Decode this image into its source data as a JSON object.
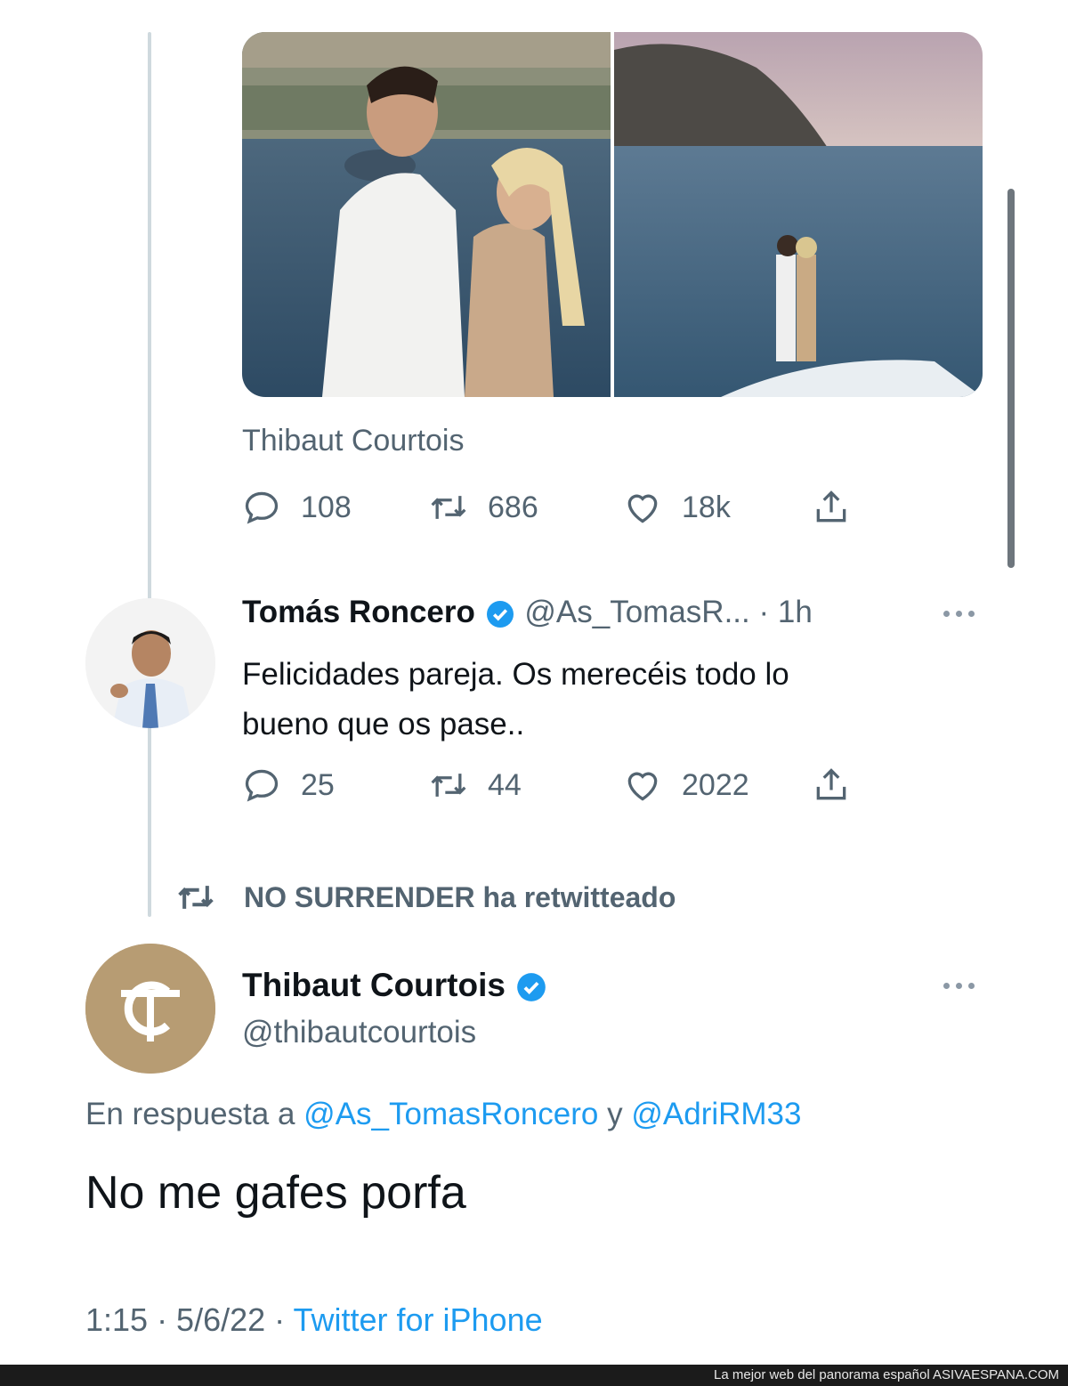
{
  "quoted_tweet": {
    "author_name": "Thibaut Courtois",
    "stats": {
      "replies": "108",
      "retweets": "686",
      "likes": "18k"
    }
  },
  "reply_tweet": {
    "author_name": "Tomás Roncero",
    "handle_time": "@As_TomasR... · 1h",
    "text_line1": "Felicidades pareja. Os merecéis todo lo",
    "text_line2": "bueno que os pase..",
    "stats": {
      "replies": "25",
      "retweets": "44",
      "likes": "2022"
    }
  },
  "retweet_notice": "NO SURRENDER ha retwitteado",
  "main_tweet": {
    "author_name": "Thibaut Courtois",
    "handle": "@thibautcourtois",
    "reply_prefix": "En respuesta a",
    "reply_user1": "@As_TomasRoncero",
    "reply_and": "y",
    "reply_user2": "@AdriRM33",
    "text": "No me gafes porfa",
    "time": "1:15 · 5/6/22 ·",
    "source": "Twitter for iPhone"
  },
  "footer": {
    "tagline": "La mejor web del panorama español",
    "site": "ASIVAESPANA.COM"
  },
  "colors": {
    "accent": "#1d9bf0",
    "muted": "#536471",
    "logo_gold": "#b79c73"
  },
  "icons": [
    "reply-icon",
    "retweet-icon",
    "like-icon",
    "share-icon",
    "verified-badge-icon",
    "more-options-icon"
  ]
}
